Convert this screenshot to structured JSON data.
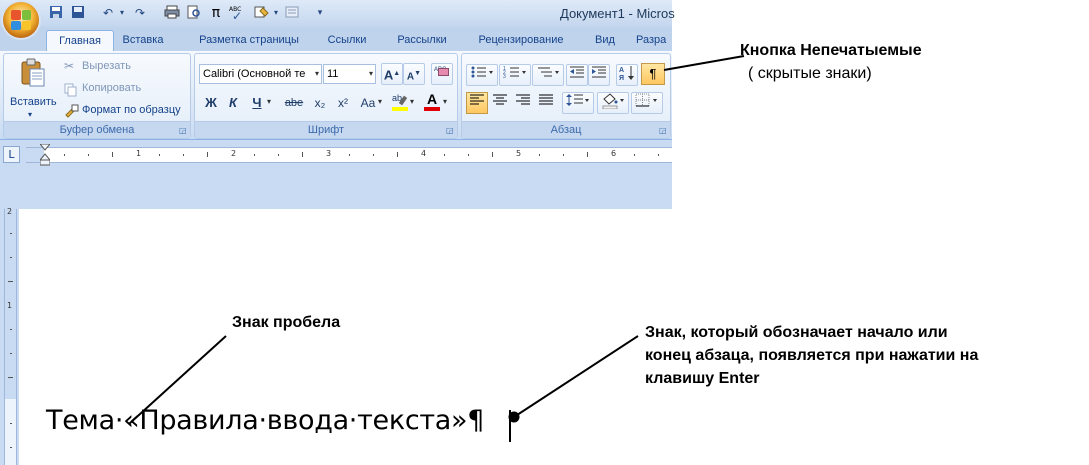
{
  "window": {
    "title": "Документ1 - Micros"
  },
  "quick_access": {
    "icons": [
      "save-icon",
      "undo-icon",
      "redo-icon",
      "print-icon",
      "print-preview-icon",
      "equation-icon",
      "spelling-icon",
      "format-painter-icon",
      "page-icon",
      "customize-icon"
    ],
    "pi_glyph": "π",
    "abc_glyph": "ABC"
  },
  "tabs": [
    {
      "label": "Главная",
      "active": true
    },
    {
      "label": "Вставка"
    },
    {
      "label": "Разметка страницы"
    },
    {
      "label": "Ссылки"
    },
    {
      "label": "Рассылки"
    },
    {
      "label": "Рецензирование"
    },
    {
      "label": "Вид"
    },
    {
      "label": "Разра"
    }
  ],
  "clipboard": {
    "paste_label": "Вставить",
    "cut_label": "Вырезать",
    "copy_label": "Копировать",
    "format_painter_label": "Формат по образцу",
    "group_label": "Буфер обмена"
  },
  "font": {
    "font_name": "Calibri (Основной те",
    "font_size": "11",
    "grow_label": "A",
    "shrink_label": "A",
    "clear_label": "ABC",
    "bold_label": "Ж",
    "italic_label": "К",
    "underline_label": "Ч",
    "strike_label": "abe",
    "subscript_label": "x₂",
    "superscript_label": "x²",
    "case_label": "Aa",
    "highlight_label": "ab",
    "color_label": "A",
    "group_label": "Шрифт"
  },
  "paragraph": {
    "pilcrow_label": "¶",
    "group_label": "Абзац"
  },
  "ruler": {
    "h_marks": [
      "1",
      "2",
      "3",
      "4",
      "5",
      "6"
    ],
    "v_marks": [
      "2",
      "1"
    ],
    "corner_glyph": "L"
  },
  "document": {
    "text": "Тема·«Правила·ввода·текста»¶"
  },
  "annotations": {
    "pilcrow_button_line1": "Кнопка Непечатыемые",
    "pilcrow_button_line2": "( скрытые знаки)",
    "space_mark": "Знак пробела",
    "paragraph_mark_line1": "Знак, который обозначает начало или",
    "paragraph_mark_line2": "конец абзаца, появляется при нажатии на",
    "paragraph_mark_line3": "клавишу Enter"
  },
  "colors": {
    "ribbon_text": "#15428b",
    "pilcrow_active": "#ffc761",
    "highlight_yellow": "#ffff00",
    "font_color_red": "#e00000"
  }
}
